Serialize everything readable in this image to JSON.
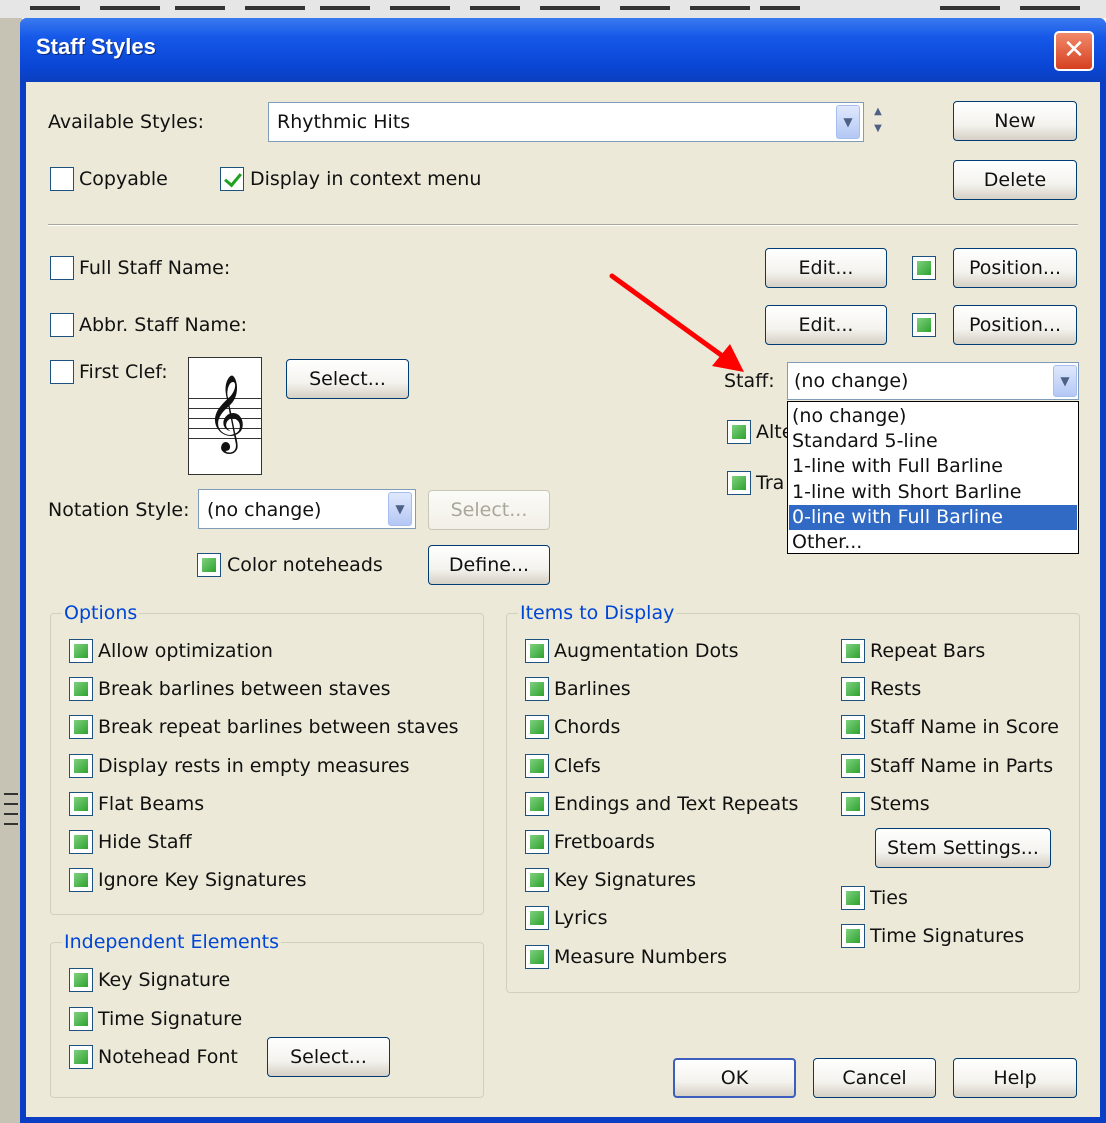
{
  "dialog": {
    "title": "Staff Styles",
    "close_glyph": "✕"
  },
  "available_styles": {
    "label": "Available Styles:",
    "value": "Rhythmic Hits"
  },
  "buttons": {
    "new": "New",
    "delete": "Delete",
    "edit1": "Edit...",
    "position1": "Position...",
    "edit2": "Edit...",
    "position2": "Position...",
    "clef_select": "Select...",
    "notation_select": "Select...",
    "define": "Define...",
    "stem_settings": "Stem Settings...",
    "notehead_select": "Select...",
    "ok": "OK",
    "cancel": "Cancel",
    "help": "Help"
  },
  "checkboxes": {
    "copyable": "Copyable",
    "display_context": "Display in context menu",
    "full_staff_name": "Full Staff Name:",
    "abbr_staff_name": "Abbr. Staff Name:",
    "first_clef": "First Clef:",
    "color_noteheads": "Color noteheads",
    "alternate_partial": "Alte",
    "transpose_partial": "Tra"
  },
  "notation_style": {
    "label": "Notation Style:",
    "value": "(no change)"
  },
  "staff": {
    "label": "Staff:",
    "value": "(no change)",
    "options": [
      "(no change)",
      "Standard 5-line",
      "1-line with Full Barline",
      "1-line with Short Barline",
      "0-line with Full Barline",
      "Other..."
    ],
    "highlighted_index": 4
  },
  "options_group": {
    "title": "Options",
    "items": [
      "Allow optimization",
      "Break barlines between staves",
      "Break repeat barlines between staves",
      "Display rests in empty measures",
      "Flat Beams",
      "Hide Staff",
      "Ignore Key Signatures"
    ]
  },
  "independent_group": {
    "title": "Independent Elements",
    "items": [
      "Key Signature",
      "Time Signature",
      "Notehead Font"
    ]
  },
  "items_group": {
    "title": "Items to Display",
    "col1": [
      "Augmentation Dots",
      "Barlines",
      "Chords",
      "Clefs",
      "Endings and Text Repeats",
      "Fretboards",
      "Key Signatures",
      "Lyrics",
      "Measure Numbers"
    ],
    "col2": [
      "Repeat Bars",
      "Rests",
      "Staff Name in Score",
      "Staff Name in Parts",
      "Stems"
    ],
    "col2b": [
      "Ties",
      "Time Signatures"
    ]
  },
  "annotation": {
    "arrow_color": "#ff0000"
  },
  "icons": {
    "combo_arrow": "chevron-down-icon",
    "spinner": "spinner-icon",
    "clef": "treble-clef-icon",
    "close": "close-icon"
  }
}
